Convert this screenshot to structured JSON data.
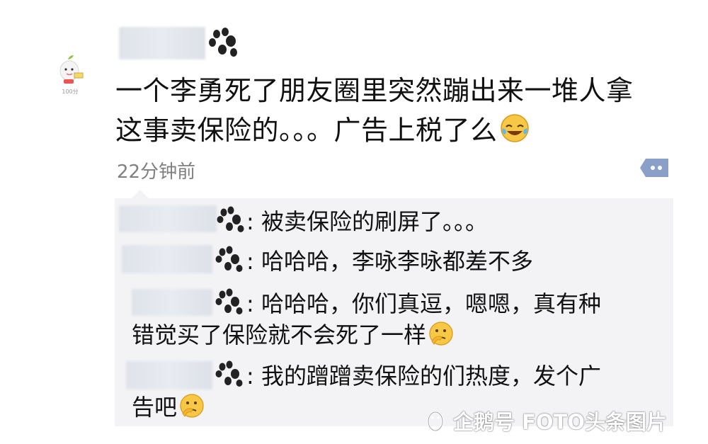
{
  "post": {
    "avatar_caption": "100分",
    "text_line1": "一个李勇死了朋友圈里突然蹦出来一堆人拿",
    "text_line2": "这事卖保险的。。。广告上税了么",
    "emoji": "face-with-tears-of-joy",
    "timestamp": "22分钟前"
  },
  "comments": [
    {
      "text": ": 被卖保险的刷屏了。。。",
      "icon": "paw-icon"
    },
    {
      "text": ": 哈哈哈，李咏李咏都差不多",
      "icon": "paw-icon"
    },
    {
      "text": ": 哈哈哈，你们真逗，嗯嗯，真有种",
      "cont": "错觉买了保险就不会死了一样",
      "emoji": "thinking-face",
      "icon": "paw-icon"
    },
    {
      "text": ": 我的蹭蹭卖保险的们热度，发个广",
      "cont": "告吧",
      "emoji": "thinking-face",
      "icon": "paw-icon"
    }
  ],
  "watermark": {
    "text": "企鹅号 FOTO头条图片"
  },
  "colors": {
    "comment_bg": "#f3f3f5",
    "timestamp": "#808080",
    "more_button": "#8aa0c8"
  }
}
